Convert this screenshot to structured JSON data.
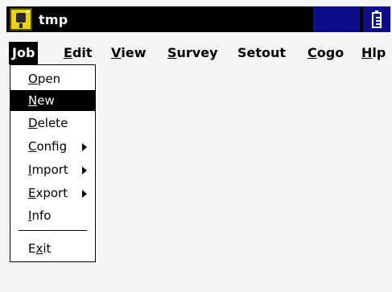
{
  "window": {
    "title": "tmp"
  },
  "menubar": {
    "items": [
      {
        "mnemonic": "J",
        "rest": "ob"
      },
      {
        "mnemonic": "E",
        "rest": "dit"
      },
      {
        "mnemonic": "V",
        "rest": "iew"
      },
      {
        "mnemonic": "S",
        "rest": "urvey"
      },
      {
        "mnemonic": "",
        "rest": "Setout"
      },
      {
        "mnemonic": "C",
        "rest": "ogo"
      },
      {
        "mnemonic": "H",
        "rest": "lp"
      }
    ]
  },
  "job_menu": {
    "items": [
      {
        "mnemonic": "O",
        "rest": "pen"
      },
      {
        "mnemonic": "N",
        "rest": "ew",
        "selected": true
      },
      {
        "mnemonic": "D",
        "rest": "elete"
      },
      {
        "mnemonic": "C",
        "rest": "onfig",
        "submenu": true
      },
      {
        "mnemonic": "I",
        "rest": "mport",
        "submenu": true
      },
      {
        "mnemonic": "E",
        "rest": "xport",
        "submenu": true
      },
      {
        "mnemonic": "I",
        "rest": "nfo"
      },
      {
        "pre": "E",
        "mnemonic": "x",
        "rest": "it"
      }
    ]
  },
  "icons": {
    "app": "survey-instrument-icon",
    "battery": "battery-icon",
    "submenu": "submenu-arrow-icon"
  },
  "colors": {
    "titlebar": "#000000",
    "status_block": "#0d0d8a",
    "app_icon": "#e8d21a",
    "selection": "#000000",
    "background": "#f4f4f4"
  }
}
